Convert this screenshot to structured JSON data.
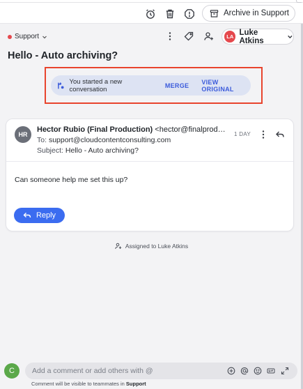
{
  "toolbar": {
    "snooze_icon": "alarm-clock-icon",
    "trash_icon": "trash-icon",
    "spam_icon": "alert-octagon-icon",
    "archive_label": "Archive in Support",
    "archive_icon": "archive-box-icon"
  },
  "header": {
    "inbox_label": "Support",
    "inbox_dot_color": "#e5484d",
    "assignee_initials": "LA",
    "assignee_name": "Luke Atkins",
    "assignee_color": "#e5484d"
  },
  "conversation": {
    "subject": "Hello - Auto archiving?"
  },
  "notice": {
    "text": "You started a new conversation",
    "merge_label": "MERGE",
    "view_original_label": "VIEW ORIGINAL"
  },
  "message": {
    "avatar_initials": "HR",
    "from_name": "Hector Rubio (Final Production)",
    "from_email": "<hector@finalproduction.com>",
    "to_label": "To:",
    "to_value": "support@cloudcontentconsulting.com",
    "subject_label": "Subject:",
    "subject_value": "Hello - Auto archiving?",
    "time": "1 DAY",
    "body": "Can someone help me set this up?",
    "reply_label": "Reply"
  },
  "activity": {
    "assigned_text": "Assigned to Luke Atkins"
  },
  "composer": {
    "avatar_initial": "C",
    "placeholder": "Add a comment or add others with @",
    "hint_prefix": "Comment will be visible to teammates in",
    "hint_inbox": "Support"
  },
  "colors": {
    "accent": "#3b6cf0",
    "highlight_border": "#e8442d",
    "notice_bg": "#dde3f3"
  }
}
